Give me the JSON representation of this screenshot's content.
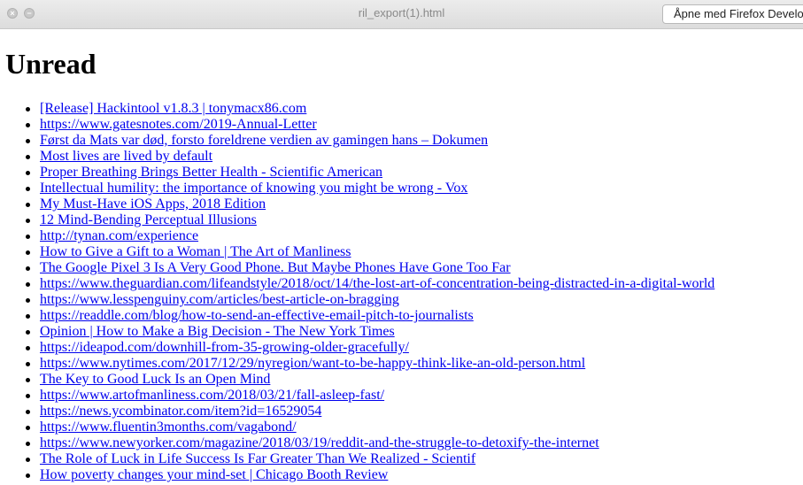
{
  "window": {
    "title": "ril_export(1).html",
    "open_with_label": "Åpne med Firefox Developer Edition",
    "close_glyph": "×",
    "minimize_glyph": "−"
  },
  "page": {
    "heading": "Unread",
    "links": [
      "[Release] Hackintool v1.8.3 | tonymacx86.com",
      "https://www.gatesnotes.com/2019-Annual-Letter",
      "Først da Mats var død, forsto foreldrene verdien av gamingen hans – Dokumen",
      "Most lives are lived by default",
      "Proper Breathing Brings Better Health - Scientific American",
      "Intellectual humility: the importance of knowing you might be wrong - Vox",
      "My Must-Have iOS Apps, 2018 Edition",
      "12 Mind-Bending Perceptual Illusions",
      "http://tynan.com/experience",
      "How to Give a Gift to a Woman | The Art of Manliness",
      "The Google Pixel 3 Is A Very Good Phone. But Maybe Phones Have Gone Too Far",
      "https://www.theguardian.com/lifeandstyle/2018/oct/14/the-lost-art-of-concentration-being-distracted-in-a-digital-world",
      "https://www.lesspenguiny.com/articles/best-article-on-bragging",
      "https://readdle.com/blog/how-to-send-an-effective-email-pitch-to-journalists",
      "Opinion | How to Make a Big Decision - The New York Times",
      "https://ideapod.com/downhill-from-35-growing-older-gracefully/",
      "https://www.nytimes.com/2017/12/29/nyregion/want-to-be-happy-think-like-an-old-person.html",
      "The Key to Good Luck Is an Open Mind",
      "https://www.artofmanliness.com/2018/03/21/fall-asleep-fast/",
      "https://news.ycombinator.com/item?id=16529054",
      "https://www.fluentin3months.com/vagabond/",
      "https://www.newyorker.com/magazine/2018/03/19/reddit-and-the-struggle-to-detoxify-the-internet",
      "The Role of Luck in Life Success Is Far Greater Than We Realized - Scientif",
      "How poverty changes your mind-set | Chicago Booth Review"
    ]
  }
}
